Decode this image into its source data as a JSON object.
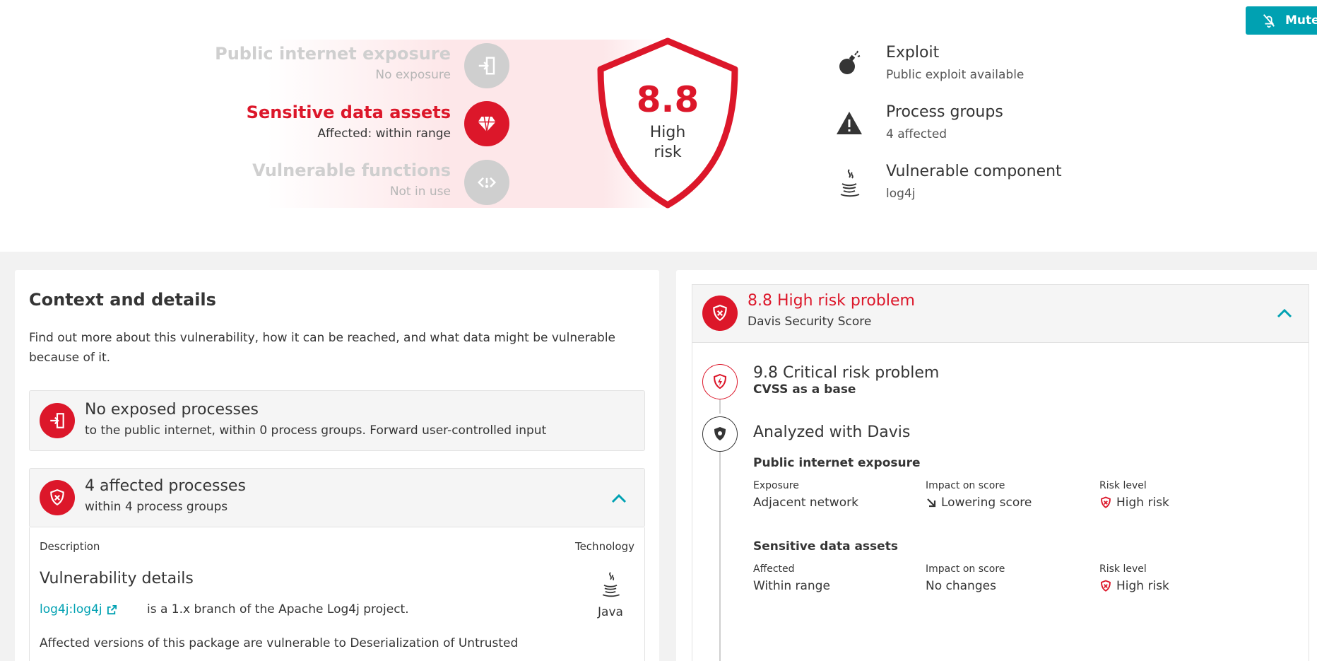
{
  "header": {
    "mute_label": "Mute",
    "factors": [
      {
        "title": "Public internet exposure",
        "subtitle": "No exposure",
        "icon": "exposure-icon",
        "active": false
      },
      {
        "title": "Sensitive data assets",
        "subtitle": "Affected: within range",
        "icon": "diamond-icon",
        "active": true
      },
      {
        "title": "Vulnerable functions",
        "subtitle": "Not in use",
        "icon": "code-icon",
        "active": false
      }
    ],
    "score": {
      "value": "8.8",
      "label_line1": "High",
      "label_line2": "risk"
    },
    "facts": [
      {
        "title": "Exploit",
        "subtitle": "Public exploit available",
        "icon": "bomb-icon"
      },
      {
        "title": "Process groups",
        "subtitle": "4 affected",
        "icon": "warning-icon"
      },
      {
        "title": "Vulnerable component",
        "subtitle": "log4j",
        "icon": "java-icon"
      }
    ]
  },
  "context": {
    "heading": "Context and details",
    "intro": "Find out more about this vulnerability, how it can be reached, and what data might be vulnerable because of it.",
    "exposed_card": {
      "title": "No exposed processes",
      "subtitle": "to the public internet, within 0 process groups. Forward user-controlled input"
    },
    "affected_card": {
      "title": "4 affected processes",
      "subtitle": "within 4 process groups"
    },
    "table": {
      "col_description": "Description",
      "col_technology": "Technology",
      "heading": "Vulnerability details",
      "link": "log4j:log4j",
      "link_text": "is a 1.x branch of the Apache Log4j project.",
      "description": "Affected versions of this package are vulnerable to Deserialization of Untrusted",
      "technology": "Java"
    }
  },
  "davis": {
    "title": "8.8 High risk problem",
    "subtitle": "Davis Security Score",
    "base_title": "9.8 Critical risk problem",
    "base_subtitle": "CVSS as a base",
    "analyzed_title": "Analyzed with Davis",
    "sections": [
      {
        "heading": "Public internet exposure",
        "col1_label": "Exposure",
        "col1_value": "Adjacent network",
        "col2_label": "Impact on score",
        "col2_value": "Lowering score",
        "col3_label": "Risk level",
        "col3_value": "High risk"
      },
      {
        "heading": "Sensitive data assets",
        "col1_label": "Affected",
        "col1_value": "Within range",
        "col2_label": "Impact on score",
        "col2_value": "No changes",
        "col3_label": "Risk level",
        "col3_value": "High risk"
      }
    ]
  },
  "colors": {
    "accent": "#00a1b2",
    "danger": "#dc172a",
    "muted": "#cfcfcf",
    "text": "#353535"
  }
}
